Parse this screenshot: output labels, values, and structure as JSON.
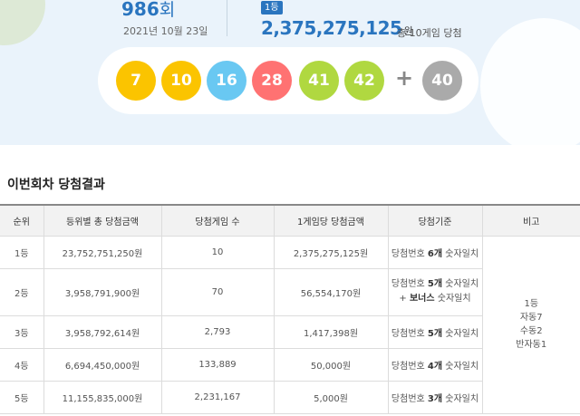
{
  "draw": {
    "round_number": "986",
    "round_suffix": "회",
    "date": "2021년 10월 23일",
    "first_badge": "1등",
    "first_prize": "2,375,275,125",
    "won": "원",
    "winners_text": "총 10게임 당첨"
  },
  "balls": [
    {
      "num": "7",
      "color": "#fbc400"
    },
    {
      "num": "10",
      "color": "#fbc400"
    },
    {
      "num": "16",
      "color": "#69c8f2"
    },
    {
      "num": "28",
      "color": "#ff7272"
    },
    {
      "num": "41",
      "color": "#b0d840"
    },
    {
      "num": "42",
      "color": "#b0d840"
    }
  ],
  "plus": "+",
  "bonus": {
    "num": "40",
    "color": "#aaaaaa"
  },
  "section_title": "이번회차 당첨결과",
  "table": {
    "headers": [
      "순위",
      "등위별 총 당첨금액",
      "당첨게임 수",
      "1게임당 당첨금액",
      "당첨기준",
      "비고"
    ],
    "rows": [
      {
        "rank": "1등",
        "total": "23,752,751,250원",
        "games": "10",
        "per_game": "2,375,275,125원",
        "crit_pre": "당첨번호 ",
        "crit_bold": "6개",
        "crit_post": " 숫자일치"
      },
      {
        "rank": "2등",
        "total": "3,958,791,900원",
        "games": "70",
        "per_game": "56,554,170원",
        "crit_pre": "당첨번호 ",
        "crit_bold": "5개",
        "crit_post": " 숫자일치",
        "crit2_pre": "+ ",
        "crit2_bold": "보너스",
        "crit2_post": " 숫자일치"
      },
      {
        "rank": "3등",
        "total": "3,958,792,614원",
        "games": "2,793",
        "per_game": "1,417,398원",
        "crit_pre": "당첨번호 ",
        "crit_bold": "5개",
        "crit_post": " 숫자일치"
      },
      {
        "rank": "4등",
        "total": "6,694,450,000원",
        "games": "133,889",
        "per_game": "50,000원",
        "crit_pre": "당첨번호 ",
        "crit_bold": "4개",
        "crit_post": " 숫자일치"
      },
      {
        "rank": "5등",
        "total": "11,155,835,000원",
        "games": "2,231,167",
        "per_game": "5,000원",
        "crit_pre": "당첨번호 ",
        "crit_bold": "3개",
        "crit_post": " 숫자일치"
      }
    ],
    "note_lines": [
      "1등",
      "자동7",
      "수동2",
      "반자동1"
    ]
  }
}
